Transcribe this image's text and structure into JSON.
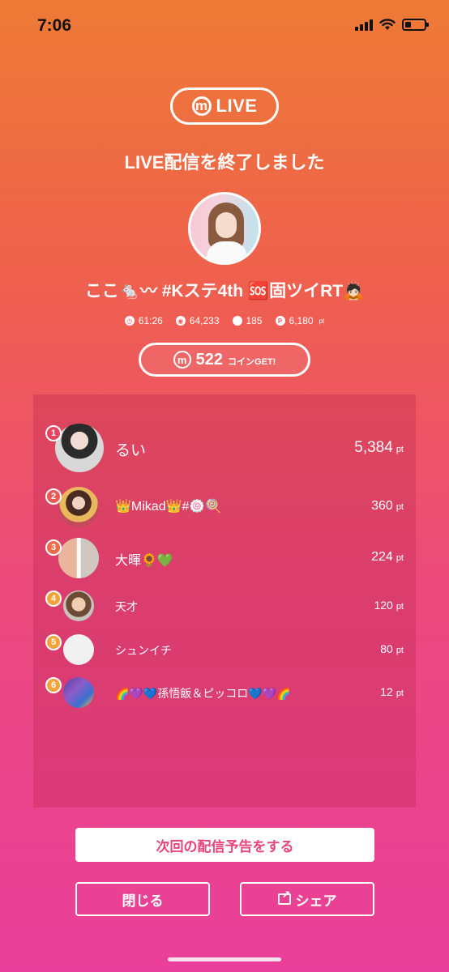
{
  "status_bar": {
    "time": "7:06",
    "battery_level": 0.3
  },
  "brand": {
    "live_label": "LIVE"
  },
  "header": {
    "title": "LIVE配信を終了しました"
  },
  "streamer": {
    "name": "ここ🐁〰 #Kステ4th 🆘固ツイRT🙇🏻"
  },
  "stats": {
    "duration": "61:26",
    "viewers": "64,233",
    "comments": "185",
    "points": "6,180",
    "points_unit": "pt"
  },
  "coins": {
    "value": "522",
    "label": "コインGET!"
  },
  "ranking": [
    {
      "rank": "1",
      "name": "るい",
      "points": "5,384",
      "unit": "pt",
      "badge_color": "#e8445f"
    },
    {
      "rank": "2",
      "name": "👑Mikad👑#🍥🍭",
      "points": "360",
      "unit": "pt",
      "badge_color": "#ec5a55"
    },
    {
      "rank": "3",
      "name": "大暉🌻💚",
      "points": "224",
      "unit": "pt",
      "badge_color": "#ee6a4a"
    },
    {
      "rank": "4",
      "name": "天才",
      "points": "120",
      "unit": "pt",
      "badge_color": "#f3a33a"
    },
    {
      "rank": "5",
      "name": "シュンイチ",
      "points": "80",
      "unit": "pt",
      "badge_color": "#f3a33a"
    },
    {
      "rank": "6",
      "name": "🌈💜💙孫悟飯＆ピッコロ💙💜🌈",
      "points": "12",
      "unit": "pt",
      "badge_color": "#f3a33a"
    }
  ],
  "actions": {
    "notice_label": "次回の配信予告をする",
    "close_label": "閉じる",
    "share_label": "シェア"
  }
}
